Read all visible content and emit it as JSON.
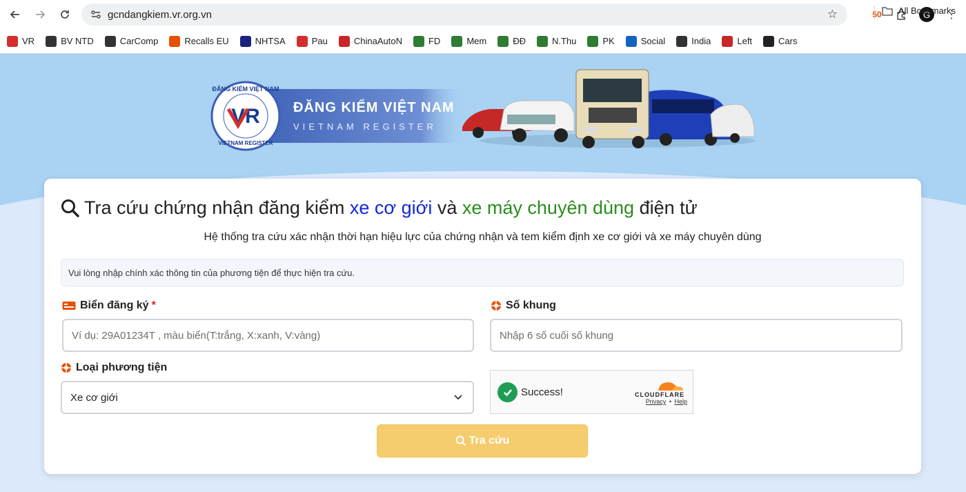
{
  "browser": {
    "url": "gcndangkiem.vr.org.vn",
    "bookmarks": [
      {
        "label": "VR",
        "icon": "vr-flag-icon",
        "color": "#d32f2f"
      },
      {
        "label": "BV NTD",
        "icon": "globe-icon",
        "color": "#333333"
      },
      {
        "label": "CarComp",
        "icon": "carcomp-icon",
        "color": "#333333"
      },
      {
        "label": "Recalls EU",
        "icon": "warning-icon",
        "color": "#e65100"
      },
      {
        "label": "NHTSA",
        "icon": "nhtsa-icon",
        "color": "#1a237e"
      },
      {
        "label": "Pau",
        "icon": "pau-icon",
        "color": "#d32f2f"
      },
      {
        "label": "ChinaAutoN",
        "icon": "cnc-icon",
        "color": "#c62828"
      },
      {
        "label": "FD",
        "icon": "download-icon",
        "color": "#2e7d32"
      },
      {
        "label": "Mem",
        "icon": "sheet-icon",
        "color": "#2e7d32"
      },
      {
        "label": "ĐĐ",
        "icon": "sheet-icon",
        "color": "#2e7d32"
      },
      {
        "label": "N.Thu",
        "icon": "sheet-icon",
        "color": "#2e7d32"
      },
      {
        "label": "PK",
        "icon": "sheet-icon",
        "color": "#2e7d32"
      },
      {
        "label": "Social",
        "icon": "doc-icon",
        "color": "#1565c0"
      },
      {
        "label": "India",
        "icon": "truck-icon",
        "color": "#333333"
      },
      {
        "label": "Left",
        "icon": "lln-icon",
        "color": "#c62828"
      },
      {
        "label": "Cars",
        "icon": "cars-icon",
        "color": "#222222"
      }
    ],
    "all_bookmarks": "All Bookmarks"
  },
  "banner": {
    "logo_ring_top": "ĐĂNG KIỂM VIỆT NAM",
    "logo_ring_bottom": "VIETNAM REGISTER",
    "logo_letters": "VR",
    "title": "ĐĂNG KIỂM VIỆT NAM",
    "subtitle": "VIETNAM REGISTER",
    "brand_color": "#3b5fb5"
  },
  "card": {
    "title_part1": "Tra cứu chứng nhận đăng kiểm",
    "title_blue": "xe cơ giới",
    "title_mid": "và",
    "title_green": "xe máy chuyên dùng",
    "title_end": "điện tử",
    "subtitle": "Hệ thống tra cứu xác nhận thời hạn hiệu lực của chứng nhận và tem kiểm định xe cơ giới và xe máy chuyên dùng",
    "alert": "Vui lòng nhập chính xác thông tin của phương tiện để thực hiện tra cứu."
  },
  "form": {
    "plate_label": "Biển đăng ký",
    "plate_required": "*",
    "plate_placeholder": "Ví dụ: 29A01234T , màu biển(T:trắng, X:xanh, V:vàng)",
    "frame_label": "Số khung",
    "frame_placeholder": "Nhập 6 số cuối số khung",
    "vehicle_type_label": "Loại phương tiện",
    "vehicle_type_value": "Xe cơ giới",
    "submit_label": "Tra cứu"
  },
  "captcha": {
    "status": "Success!",
    "brand": "CLOUDFLARE",
    "privacy": "Privacy",
    "sep": "•",
    "help": "Help"
  },
  "colors": {
    "accent_blue": "#1028d8",
    "accent_green": "#2a8c1f",
    "submit_bg": "#f5cc6e",
    "hero_bg": "#a9d2f3"
  }
}
